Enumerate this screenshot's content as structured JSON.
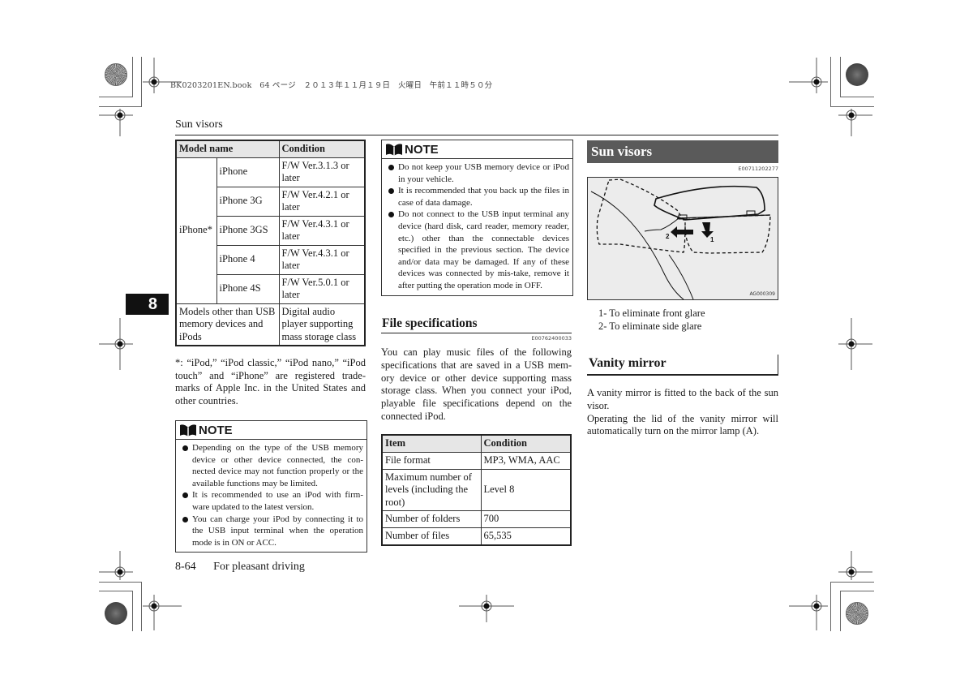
{
  "book_meta": "BK0203201EN.book　64 ページ　２０１３年１１月１９日　火曜日　午前１１時５０分",
  "running_title": "Sun visors",
  "chapter_tab": "8",
  "model_table": {
    "headers": [
      "Model name",
      "Condition"
    ],
    "group_label": "iPhone*",
    "group_rows": [
      {
        "model": "iPhone",
        "condition": "F/W Ver.3.1.3 or later"
      },
      {
        "model": "iPhone 3G",
        "condition": "F/W Ver.4.2.1 or later"
      },
      {
        "model": "iPhone 3GS",
        "condition": "F/W Ver.4.3.1 or later"
      },
      {
        "model": "iPhone 4",
        "condition": "F/W Ver.4.3.1 or later"
      },
      {
        "model": "iPhone 4S",
        "condition": "F/W Ver.5.0.1 or later"
      }
    ],
    "other_row": {
      "model": "Models other than USB memory devices and iPods",
      "condition": "Digital audio player supporting mass storage class"
    }
  },
  "footnote": "*: “iPod,” “iPod classic,” “iPod nano,” “iPod touch” and “iPhone” are registered trade-marks of Apple Inc. in the United States and other countries.",
  "note1": {
    "title": "NOTE",
    "items": [
      "Depending on the type of the USB memory device or other device connected, the con-nected device may not function properly or the available functions may be limited.",
      "It is recommended to use an iPod with firm-ware updated to the latest version.",
      "You can charge your iPod by connecting it to the USB input terminal when the operation mode is in ON or ACC."
    ]
  },
  "note2": {
    "title": "NOTE",
    "items": [
      "Do not keep your USB memory device or iPod in your vehicle.",
      "It is recommended that you back up the files in case of data damage.",
      "Do not connect to the USB input terminal any device (hard disk, card reader, memory reader, etc.) other than the connectable devices specified in the previous section. The device and/or data may be damaged. If any of these devices was connected by mis-take, remove it after putting the operation mode in OFF."
    ]
  },
  "file_specs": {
    "heading": "File specifications",
    "code": "E00762400033",
    "body": "You can play music files of the following specifications that are saved in a USB mem-ory device or other device supporting mass storage class. When you connect your iPod, playable file specifications depend on the connected iPod.",
    "table": {
      "headers": [
        "Item",
        "Condition"
      ],
      "rows": [
        [
          "File format",
          "MP3, WMA, AAC"
        ],
        [
          "Maximum number of levels (including the root)",
          "Level 8"
        ],
        [
          "Number of folders",
          "700"
        ],
        [
          "Number of files",
          "65,535"
        ]
      ]
    }
  },
  "sun_visors": {
    "heading": "Sun visors",
    "code": "E00711202277",
    "figure_code": "AG000309",
    "figure_labels": [
      "1",
      "2"
    ],
    "legend": [
      "1- To eliminate front glare",
      "2- To eliminate side glare"
    ]
  },
  "vanity_mirror": {
    "heading": "Vanity mirror",
    "paragraphs": [
      "A vanity mirror is fitted to the back of the sun visor.",
      "Operating the lid of the vanity mirror will automatically turn on the mirror lamp (A)."
    ]
  },
  "footer": {
    "page_number": "8-64",
    "section": "For pleasant driving"
  }
}
